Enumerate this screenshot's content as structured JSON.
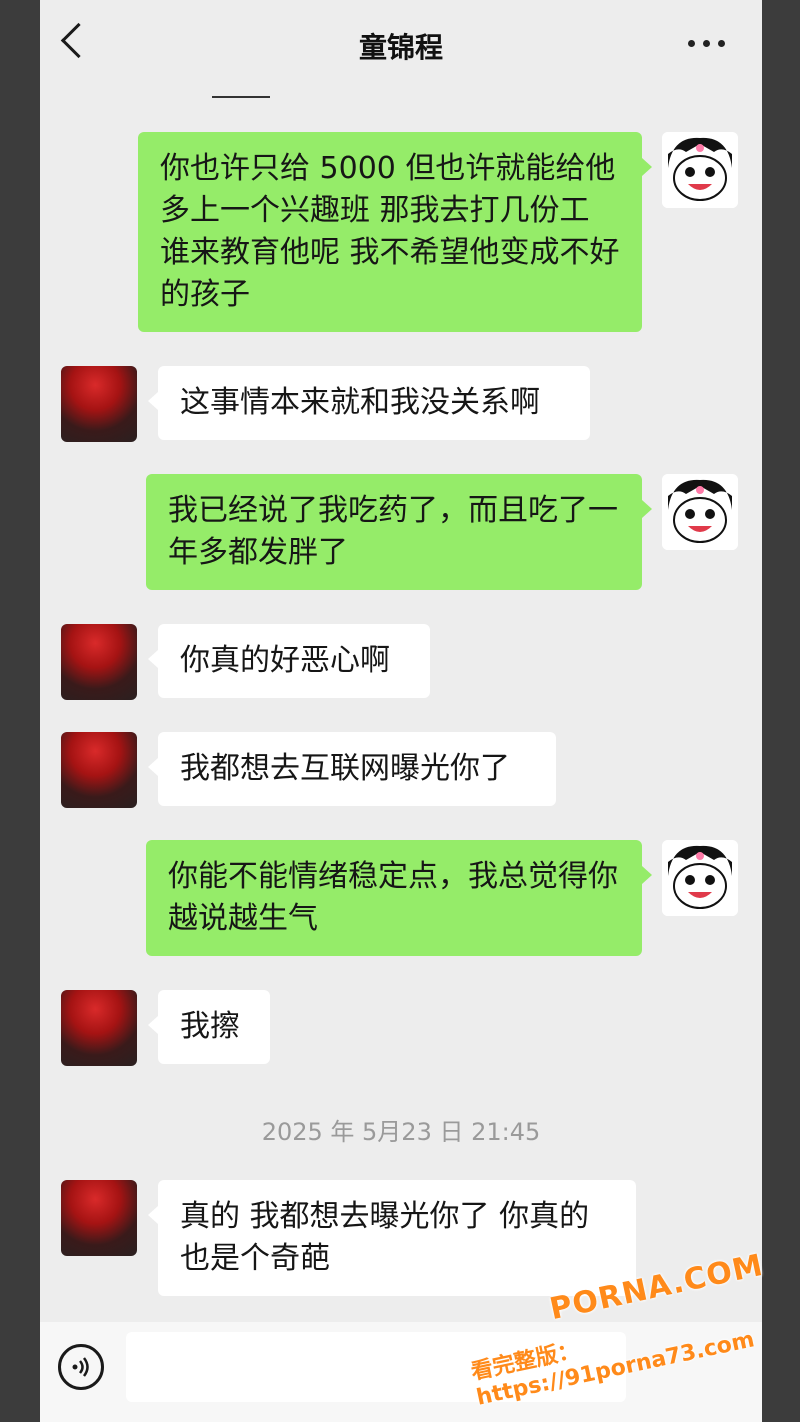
{
  "header": {
    "title": "童锦程"
  },
  "messages": [
    {
      "side": "right",
      "text": "你也许只给 5000 但也许就能给他多上一个兴趣班 那我去打几份工 谁来教育他呢 我不希望他变成不好的孩子"
    },
    {
      "side": "left",
      "text": "这事情本来就和我没关系啊"
    },
    {
      "side": "right",
      "text": "我已经说了我吃药了，而且吃了一年多都发胖了"
    },
    {
      "side": "left",
      "text": "你真的好恶心啊"
    },
    {
      "side": "left",
      "text": "我都想去互联网曝光你了"
    },
    {
      "side": "right",
      "text": "你能不能情绪稳定点，我总觉得你越说越生气"
    },
    {
      "side": "left",
      "text": "我擦"
    },
    {
      "side": "left",
      "text": "真的 我都想去曝光你了 你真的也是个奇葩"
    }
  ],
  "timestamp": "2025 年 5月23 日 21:45",
  "watermark": {
    "logo": "PORNA.COM",
    "line": "看完整版：https://91porna73.com"
  },
  "colors": {
    "green_bubble": "#95ec69",
    "white_bubble": "#ffffff",
    "background": "#ededed"
  },
  "icons": [
    "back-chevron-icon",
    "more-dots-icon",
    "voice-icon"
  ]
}
